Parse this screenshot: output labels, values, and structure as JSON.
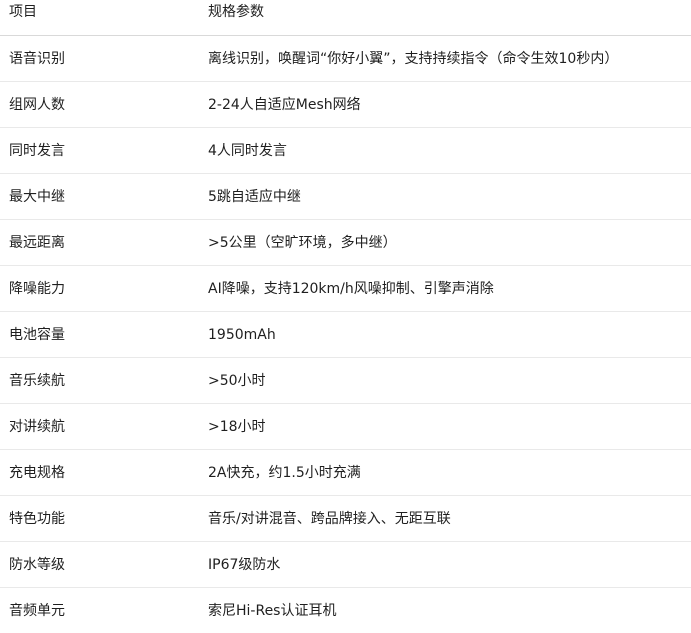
{
  "table": {
    "headers": [
      "项目",
      "规格参数"
    ],
    "rows": [
      [
        "语音识别",
        "离线识别，唤醒词“你好小翼”，支持持续指令（命令生效10秒内）"
      ],
      [
        "组网人数",
        "2-24人自适应Mesh网络"
      ],
      [
        "同时发言",
        "4人同时发言"
      ],
      [
        "最大中继",
        "5跳自适应中继"
      ],
      [
        "最远距离",
        ">5公里（空旷环境，多中继）"
      ],
      [
        "降噪能力",
        "AI降噪，支持120km/h风噪抑制、引擎声消除"
      ],
      [
        "电池容量",
        "1950mAh"
      ],
      [
        "音乐续航",
        ">50小时"
      ],
      [
        "对讲续航",
        ">18小时"
      ],
      [
        "充电规格",
        "2A快充，约1.5小时充满"
      ],
      [
        "特色功能",
        "音乐/对讲混音、跨品牌接入、无距互联"
      ],
      [
        "防水等级",
        "IP67级防水"
      ],
      [
        "音频单元",
        "索尼Hi-Res认证耳机"
      ]
    ]
  }
}
